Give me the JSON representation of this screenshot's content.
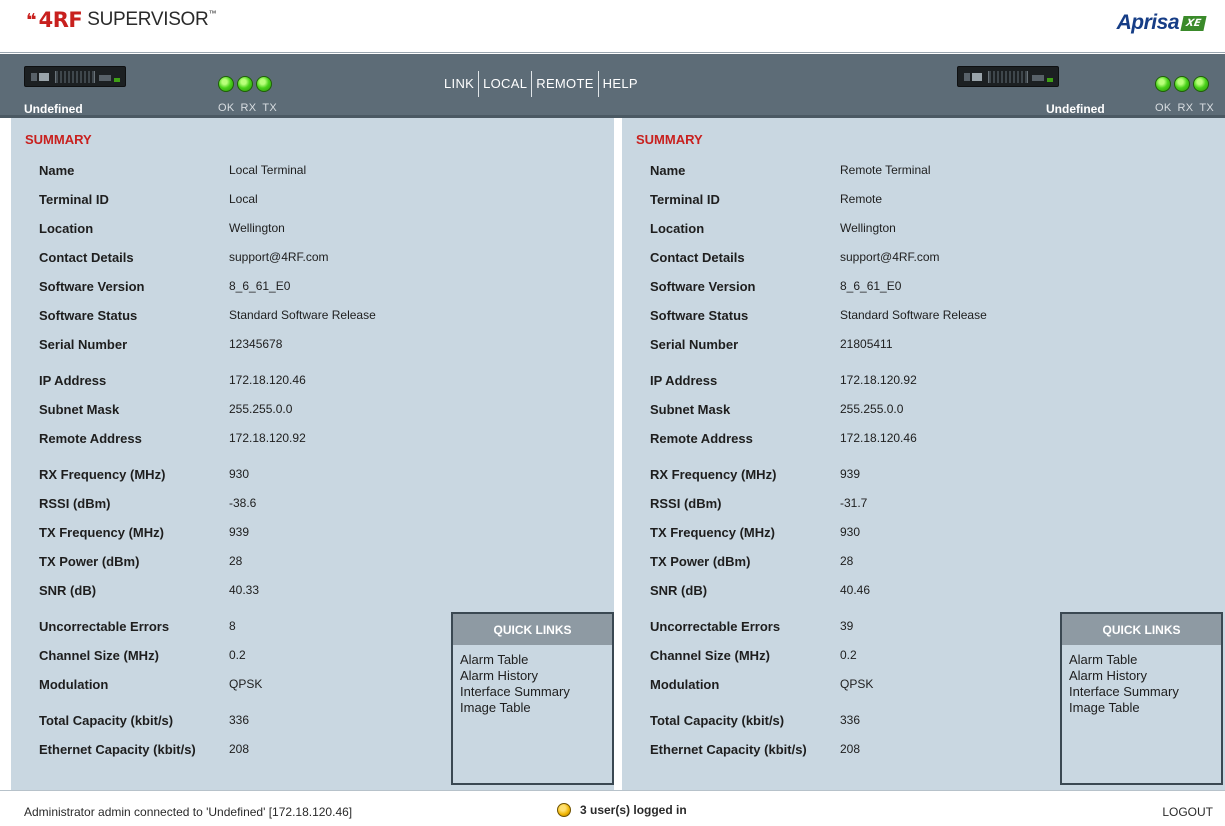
{
  "header": {
    "logo_mark": "❝",
    "logo_brand": "4RF",
    "logo_product": "SUPERVISOR",
    "logo_tm": "™",
    "aprisa_text": "Aprisa",
    "aprisa_badge": "XE"
  },
  "nav": {
    "left_device_label": "Undefined",
    "right_device_label": "Undefined",
    "led_labels": [
      "OK",
      "RX",
      "TX"
    ],
    "links": [
      "LINK",
      "LOCAL",
      "REMOTE",
      "HELP"
    ]
  },
  "local": {
    "title": "SUMMARY",
    "rows": [
      {
        "label": "Name",
        "value": "Local Terminal"
      },
      {
        "label": "Terminal ID",
        "value": "Local"
      },
      {
        "label": "Location",
        "value": "Wellington"
      },
      {
        "label": "Contact Details",
        "value": "support@4RF.com"
      },
      {
        "label": "Software Version",
        "value": "8_6_61_E0"
      },
      {
        "label": "Software Status",
        "value": "Standard Software Release"
      },
      {
        "label": "Serial Number",
        "value": "12345678"
      },
      {
        "label": "IP Address",
        "value": "172.18.120.46"
      },
      {
        "label": "Subnet Mask",
        "value": "255.255.0.0"
      },
      {
        "label": "Remote Address",
        "value": "172.18.120.92"
      },
      {
        "label": "RX Frequency (MHz)",
        "value": "930"
      },
      {
        "label": "RSSI (dBm)",
        "value": "-38.6"
      },
      {
        "label": "TX Frequency (MHz)",
        "value": "939"
      },
      {
        "label": "TX Power (dBm)",
        "value": "28"
      },
      {
        "label": "SNR (dB)",
        "value": "40.33"
      },
      {
        "label": "Uncorrectable Errors",
        "value": "8"
      },
      {
        "label": "Channel Size (MHz)",
        "value": "0.2"
      },
      {
        "label": "Modulation",
        "value": "QPSK"
      },
      {
        "label": "Total Capacity (kbit/s)",
        "value": "336"
      },
      {
        "label": "Ethernet Capacity (kbit/s)",
        "value": "208"
      }
    ]
  },
  "remote": {
    "title": "SUMMARY",
    "rows": [
      {
        "label": "Name",
        "value": "Remote Terminal"
      },
      {
        "label": "Terminal ID",
        "value": "Remote"
      },
      {
        "label": "Location",
        "value": "Wellington"
      },
      {
        "label": "Contact Details",
        "value": "support@4RF.com"
      },
      {
        "label": "Software Version",
        "value": "8_6_61_E0"
      },
      {
        "label": "Software Status",
        "value": "Standard Software Release"
      },
      {
        "label": "Serial Number",
        "value": "21805411"
      },
      {
        "label": "IP Address",
        "value": "172.18.120.92"
      },
      {
        "label": "Subnet Mask",
        "value": "255.255.0.0"
      },
      {
        "label": "Remote Address",
        "value": "172.18.120.46"
      },
      {
        "label": "RX Frequency (MHz)",
        "value": "939"
      },
      {
        "label": "RSSI (dBm)",
        "value": "-31.7"
      },
      {
        "label": "TX Frequency (MHz)",
        "value": "930"
      },
      {
        "label": "TX Power (dBm)",
        "value": "28"
      },
      {
        "label": "SNR (dB)",
        "value": "40.46"
      },
      {
        "label": "Uncorrectable Errors",
        "value": "39"
      },
      {
        "label": "Channel Size (MHz)",
        "value": "0.2"
      },
      {
        "label": "Modulation",
        "value": "QPSK"
      },
      {
        "label": "Total Capacity (kbit/s)",
        "value": "336"
      },
      {
        "label": "Ethernet Capacity (kbit/s)",
        "value": "208"
      }
    ]
  },
  "quick_links": {
    "title": "QUICK LINKS",
    "items": [
      "Alarm Table",
      "Alarm History",
      "Interface Summary",
      "Image Table"
    ]
  },
  "footer": {
    "status": "Administrator admin connected to 'Undefined' [172.18.120.46]",
    "users": "3 user(s) logged in",
    "logout": "LOGOUT"
  },
  "colors": {
    "accent_red": "#c8201e",
    "panel_bg": "#c9d7e1",
    "nav_bg": "#5d6c77",
    "led_green": "#49d21a",
    "user_dot": "#f0b400"
  }
}
